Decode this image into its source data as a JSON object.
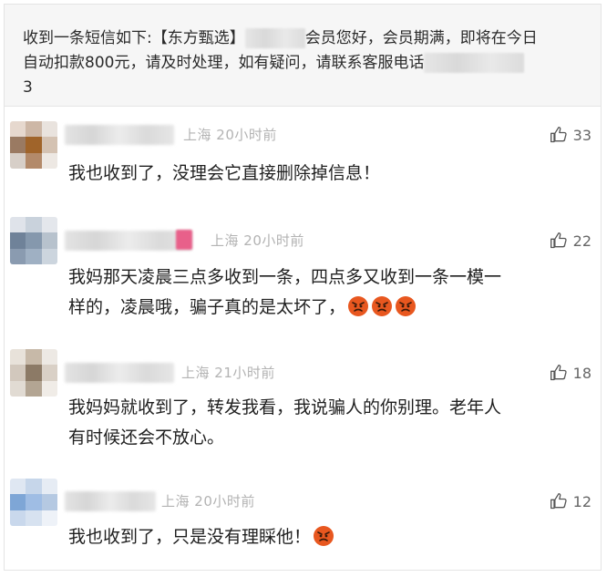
{
  "post": {
    "line1_prefix": "收到一条短信如下:【东方甄选】",
    "line1_suffix": "会员您好，会员期满，即将在今日",
    "line2": "自动扣款800元，请及时处理，如有疑问，请联系客服电话",
    "line3": "3"
  },
  "comments": [
    {
      "location": "上海",
      "time": "20小时前",
      "likes": "33",
      "text": "我也收到了，没理会它直接删除掉信息！"
    },
    {
      "location": "上海",
      "time": "20小时前",
      "likes": "22",
      "text_line1": "我妈那天凌晨三点多收到一条，四点多又收到一条一模一",
      "text_line2": "样的，凌晨哦，骗子真的是太坏了，",
      "emoji": "angry-face-icon"
    },
    {
      "location": "上海",
      "time": "21小时前",
      "likes": "18",
      "text_line1": "我妈妈就收到了，转发我看，我说骗人的你别理。老年人",
      "text_line2": "有时候还会不放心。"
    },
    {
      "location": "上海",
      "time": "20小时前",
      "likes": "12",
      "text": "我也收到了，只是没有理睬他！",
      "emoji": "angry-face-icon"
    }
  ],
  "colors": {
    "meta": "#b3b3b3",
    "text": "#1f1f1f",
    "emoji": "#e8571f",
    "post_bg": "#f6f6f6"
  }
}
